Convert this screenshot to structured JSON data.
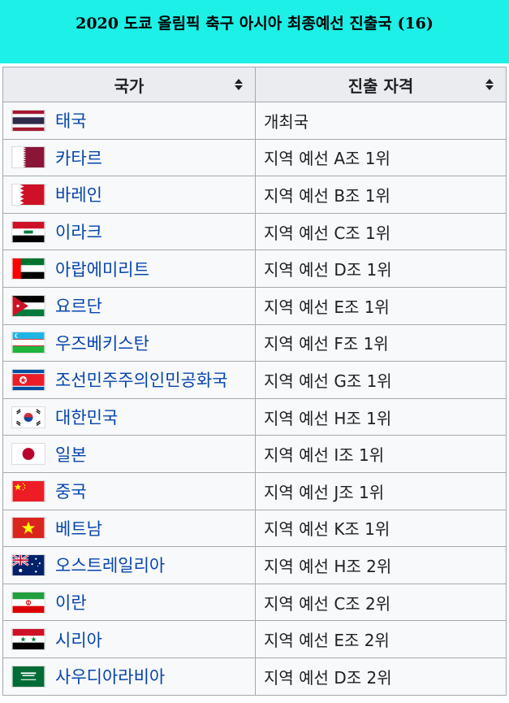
{
  "title": "2020 도쿄 올림픽 축구 아시아 최종예선 진출국 (16)",
  "headers": {
    "country": "국가",
    "qualification": "진출 자격"
  },
  "rows": [
    {
      "country": "태국",
      "qualification": "개최국",
      "flag": "thailand-flag"
    },
    {
      "country": "카타르",
      "qualification": "지역 예선 A조 1위",
      "flag": "qatar-flag"
    },
    {
      "country": "바레인",
      "qualification": "지역 예선 B조 1위",
      "flag": "bahrain-flag"
    },
    {
      "country": "이라크",
      "qualification": "지역 예선 C조 1위",
      "flag": "iraq-flag"
    },
    {
      "country": "아랍에미리트",
      "qualification": "지역 예선 D조 1위",
      "flag": "uae-flag"
    },
    {
      "country": "요르단",
      "qualification": "지역 예선 E조 1위",
      "flag": "jordan-flag"
    },
    {
      "country": "우즈베키스탄",
      "qualification": "지역 예선 F조 1위",
      "flag": "uzbekistan-flag"
    },
    {
      "country": "조선민주주의인민공화국",
      "qualification": "지역 예선 G조 1위",
      "flag": "north-korea-flag"
    },
    {
      "country": "대한민국",
      "qualification": "지역 예선 H조 1위",
      "flag": "south-korea-flag"
    },
    {
      "country": "일본",
      "qualification": "지역 예선 I조 1위",
      "flag": "japan-flag"
    },
    {
      "country": "중국",
      "qualification": "지역 예선 J조 1위",
      "flag": "china-flag"
    },
    {
      "country": "베트남",
      "qualification": "지역 예선 K조 1위",
      "flag": "vietnam-flag"
    },
    {
      "country": "오스트레일리아",
      "qualification": "지역 예선 H조 2위",
      "flag": "australia-flag"
    },
    {
      "country": "이란",
      "qualification": "지역 예선 C조 2위",
      "flag": "iran-flag"
    },
    {
      "country": "시리아",
      "qualification": "지역 예선 E조 2위",
      "flag": "syria-flag"
    },
    {
      "country": "사우디아라비아",
      "qualification": "지역 예선 D조 2위",
      "flag": "saudi-arabia-flag"
    }
  ],
  "colors": {
    "title_bg": "#1df0e7",
    "header_bg": "#eaecf0",
    "link": "#0645ad",
    "border": "#a2a9b1"
  }
}
